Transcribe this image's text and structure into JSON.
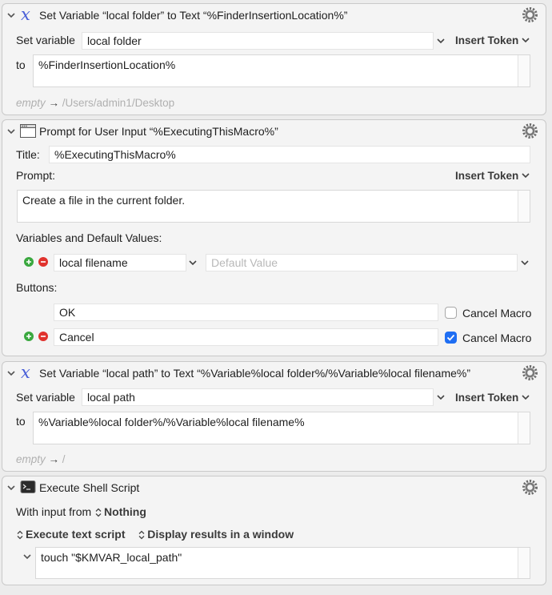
{
  "actions": [
    {
      "title": "Set Variable “local folder” to Text “%FinderInsertionLocation%”",
      "set_variable_label": "Set variable",
      "variable": "local folder",
      "insert_token": "Insert Token",
      "to_label": "to",
      "text": "%FinderInsertionLocation%",
      "preview_empty": "empty",
      "preview_value": "/Users/admin1/Desktop"
    },
    {
      "title": "Prompt for User Input “%ExecutingThisMacro%”",
      "title_label": "Title:",
      "title_value": "%ExecutingThisMacro%",
      "prompt_label": "Prompt:",
      "insert_token": "Insert Token",
      "prompt_text": "Create a file in the current folder.",
      "variables_label": "Variables and Default Values:",
      "variable_name": "local filename",
      "default_placeholder": "Default Value",
      "buttons_label": "Buttons:",
      "buttons": [
        {
          "label": "OK",
          "cancel_macro": "Cancel Macro",
          "checked": false
        },
        {
          "label": "Cancel",
          "cancel_macro": "Cancel Macro",
          "checked": true
        }
      ]
    },
    {
      "title": "Set Variable “local path” to Text “%Variable%local folder%/%Variable%local filename%”",
      "set_variable_label": "Set variable",
      "variable": "local path",
      "insert_token": "Insert Token",
      "to_label": "to",
      "text": "%Variable%local folder%/%Variable%local filename%",
      "preview_empty": "empty",
      "preview_value": "/"
    },
    {
      "title": "Execute Shell Script",
      "input_label": "With input from",
      "input_value": "Nothing",
      "mode": "Execute text script",
      "output": "Display results in a window",
      "script": "touch \"$KMVAR_local_path\""
    }
  ],
  "colors": {
    "accent": "#1f6ef3",
    "add": "#3aa83f",
    "remove": "#e0322d",
    "variable_icon": "#4a5fd8"
  },
  "icons": {
    "variable": "variable-x-icon",
    "prompt": "window-icon",
    "shell": "terminal-icon",
    "gear": "gear-icon"
  }
}
